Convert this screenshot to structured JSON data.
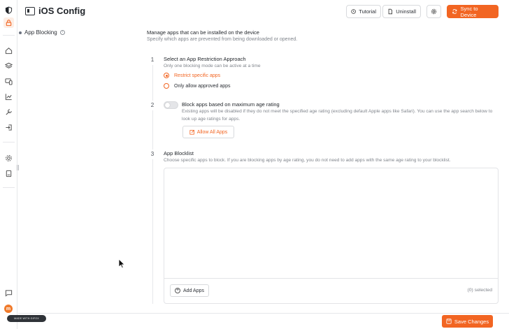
{
  "header": {
    "title": "iOS Config",
    "tutorial_label": "Tutorial",
    "uninstall_label": "Uninstall",
    "sync_label": "Sync to Device"
  },
  "secnav": {
    "item": "App Blocking"
  },
  "main": {
    "title": "Manage apps that can be installed on the device",
    "subtitle": "Specify which apps are prevented from being downloaded or opened."
  },
  "step1": {
    "num": "1",
    "heading": "Select an App Restriction Approach",
    "desc": "Only one blocking mode can be active at a time",
    "options": [
      "Restrict specific apps",
      "Only allow approved apps"
    ],
    "selected": "Restrict specific apps"
  },
  "step2": {
    "num": "2",
    "heading": "Block apps based on maximum age rating",
    "desc": "Existing apps will be disabled if they do not meet the specified age rating (excluding default Apple apps like Safari). You can use the app search below to look up age ratings for apps.",
    "toggle_on": false,
    "allow_all_label": "Allow All Apps"
  },
  "step3": {
    "num": "3",
    "heading": "App Blocklist",
    "desc": "Choose specific apps to block. If you are blocking apps by age rating, you do not need to add apps with the same age rating to your blocklist.",
    "add_label": "Add Apps",
    "selected_text": "(0) selected"
  },
  "footer": {
    "save_label": "Save Changes",
    "badge": "MADE WITH GIFOX"
  },
  "rail": {
    "avatar_letter": "m",
    "icons": [
      "shield-logo-icon",
      "lock-icon",
      "home-icon",
      "layers-icon",
      "devices-icon",
      "chart-icon",
      "tools-icon",
      "login-icon",
      "settings-icon",
      "book-icon",
      "chat-icon"
    ]
  },
  "colors": {
    "accent": "#f26522",
    "muted": "#80858c",
    "border": "#e3e4e7"
  }
}
